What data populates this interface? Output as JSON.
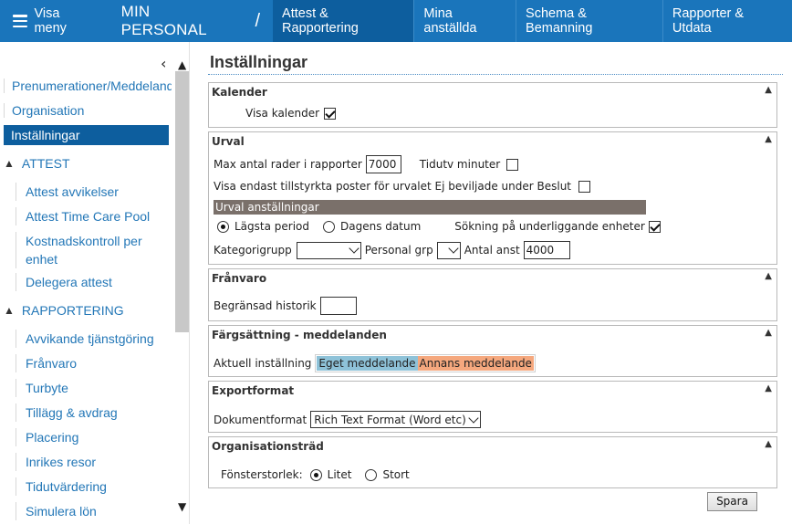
{
  "topbar": {
    "menu_label": "Visa meny",
    "app_title": "MIN PERSONAL",
    "separator": "/",
    "tabs": [
      {
        "label": "Attest & Rapportering",
        "active": true
      },
      {
        "label": "Mina anställda",
        "active": false
      },
      {
        "label": "Schema & Bemanning",
        "active": false
      },
      {
        "label": "Rapporter & Utdata",
        "active": false
      }
    ]
  },
  "sidebar": {
    "top_items": [
      {
        "label": "Prenumerationer/Meddelande"
      },
      {
        "label": "Organisation"
      },
      {
        "label": "Inställningar",
        "active": true
      }
    ],
    "sections": [
      {
        "label": "ATTEST",
        "items": [
          "Attest avvikelser",
          "Attest Time Care Pool",
          "Kostnadskontroll per enhet",
          "Delegera attest"
        ]
      },
      {
        "label": "RAPPORTERING",
        "items": [
          "Avvikande tjänstgöring",
          "Frånvaro",
          "Turbyte",
          "Tillägg & avdrag",
          "Placering",
          "Inrikes resor",
          "Tidutvärdering",
          "Simulera lön"
        ]
      }
    ]
  },
  "main": {
    "title": "Inställningar",
    "kalender": {
      "title": "Kalender",
      "visa_kalender_label": "Visa kalender",
      "visa_kalender_checked": true
    },
    "urval": {
      "title": "Urval",
      "max_rows_label": "Max antal rader i rapporter",
      "max_rows_value": "7000",
      "tidutv_label": "Tidutv minuter",
      "tidutv_checked": false,
      "visa_endast_label": "Visa endast tillstyrkta poster för urvalet Ej beviljade under Beslut",
      "visa_endast_checked": false,
      "sub_header": "Urval anställningar",
      "radio_lagsta": "Lägsta period",
      "radio_dagens": "Dagens datum",
      "radio_selected": "Lägsta period",
      "sokning_label": "Sökning på underliggande enheter",
      "sokning_checked": true,
      "kategorigrupp_label": "Kategorigrupp",
      "kategorigrupp_value": "",
      "personal_grp_label": "Personal grp",
      "personal_grp_value": "",
      "antal_anst_label": "Antal anst",
      "antal_anst_value": "4000"
    },
    "franvaro": {
      "title": "Frånvaro",
      "begransad_label": "Begränsad historik",
      "begransad_value": ""
    },
    "fargsattning": {
      "title": "Färgsättning - meddelanden",
      "aktuell_label": "Aktuell inställning",
      "eget": "Eget meddelande",
      "annans": "Annans meddelande",
      "eget_color": "#8ec2d8",
      "annans_color": "#f5a87e"
    },
    "exportformat": {
      "title": "Exportformat",
      "dokumentformat_label": "Dokumentformat",
      "dokumentformat_value": "Rich Text Format (Word etc)"
    },
    "organisationstrad": {
      "title": "Organisationsträd",
      "fonsterstorlek_label": "Fönsterstorlek:",
      "radio_litet": "Litet",
      "radio_stort": "Stort",
      "selected": "Litet"
    },
    "save_label": "Spara"
  },
  "colors": {
    "topbar": "#1a75bb",
    "active_tab": "#0d5e9e",
    "link": "#2377b7"
  }
}
